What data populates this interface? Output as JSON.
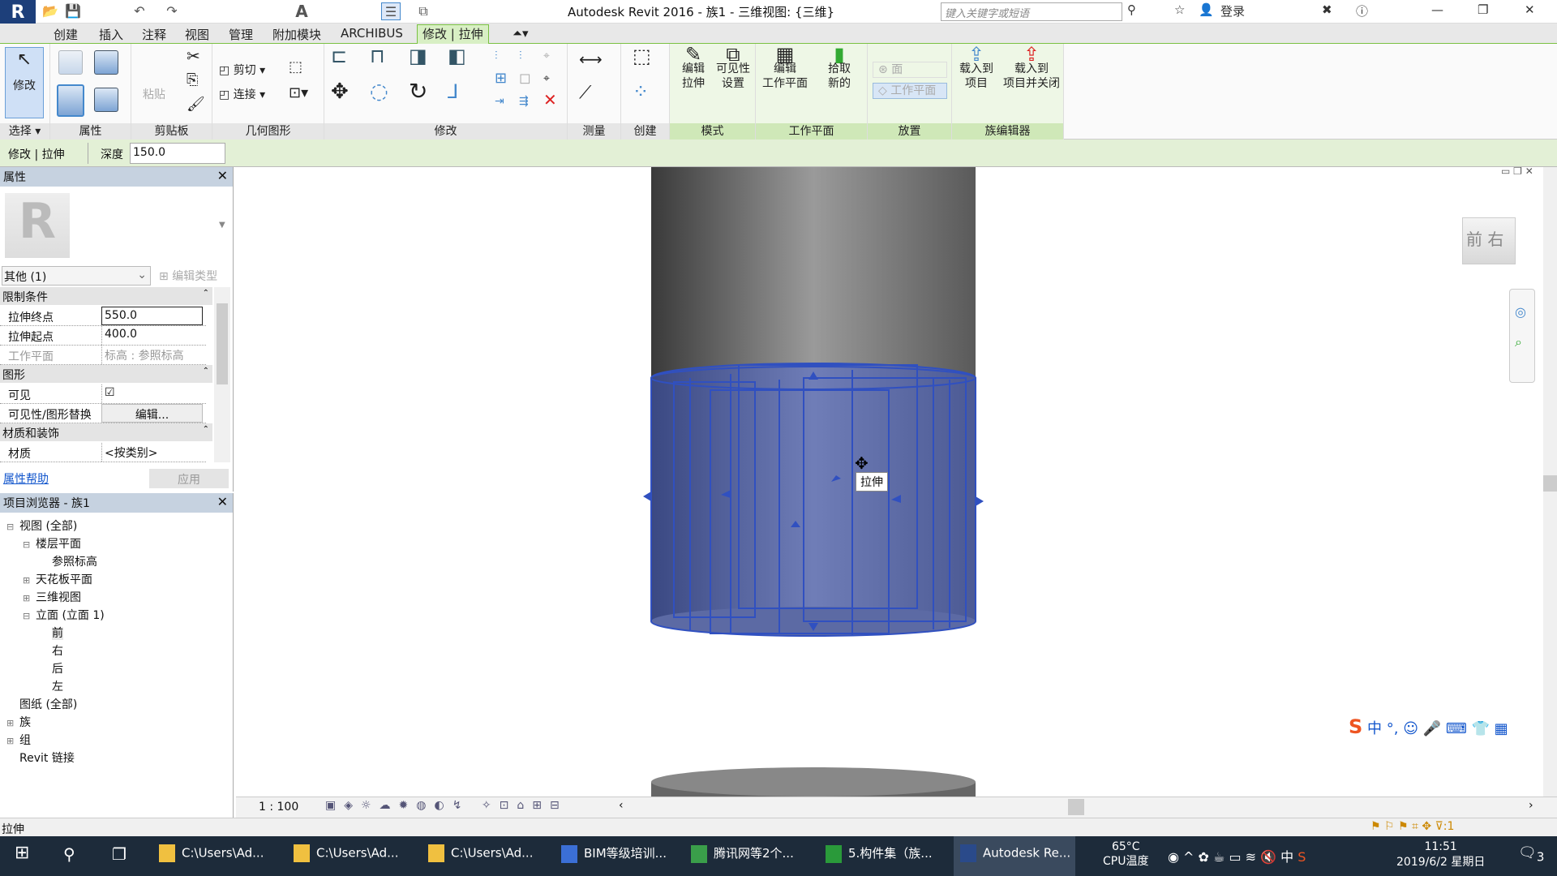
{
  "title": "Autodesk Revit 2016 -    族1 - 三维视图: {三维}",
  "search_placeholder": "键入关键字或短语",
  "login": "登录",
  "tabs": [
    "创建",
    "插入",
    "注释",
    "视图",
    "管理",
    "附加模块",
    "ARCHIBUS",
    "修改 | 拉伸"
  ],
  "ribbon": {
    "modify": "修改",
    "select": "选择 ▾",
    "properties": "属性",
    "clipboard": "剪贴板",
    "paste": "粘贴",
    "cut": "剪切",
    "join": "连接",
    "geometry": "几何图形",
    "modify_panel": "修改",
    "measure": "测量",
    "create": "创建",
    "edit_extrusion": [
      "编辑",
      "拉伸"
    ],
    "visibility": [
      "可见性",
      "设置"
    ],
    "mode": "模式",
    "edit_workplane": [
      "编辑",
      "工作平面"
    ],
    "pick_new": [
      "拾取",
      "新的"
    ],
    "workplane": "工作平面",
    "face": "面",
    "workplane_btn": "工作平面",
    "place": "放置",
    "load_project": [
      "载入到",
      "项目"
    ],
    "load_close": [
      "载入到",
      "项目并关闭"
    ],
    "family_editor": "族编辑器"
  },
  "optbar": {
    "context": "修改 | 拉伸",
    "depth_label": "深度",
    "depth_value": "150.0"
  },
  "properties": {
    "title": "属性",
    "type": "其他 (1)",
    "edit_type": "编辑类型",
    "categories": [
      "限制条件",
      "图形",
      "材质和装饰"
    ],
    "rows": [
      {
        "k": "拉伸终点",
        "v": "550.0"
      },
      {
        "k": "拉伸起点",
        "v": "400.0"
      },
      {
        "k": "工作平面",
        "v": "标高 : 参照标高"
      },
      {
        "k": "可见",
        "v": "☑"
      },
      {
        "k": "可见性/图形替换",
        "v": "编辑..."
      },
      {
        "k": "材质",
        "v": "<按类别>"
      }
    ],
    "help": "属性帮助",
    "apply": "应用"
  },
  "browser": {
    "title": "项目浏览器 - 族1",
    "nodes": [
      {
        "t": "视图 (全部)",
        "lvl": 0,
        "exp": "⊟"
      },
      {
        "t": "楼层平面",
        "lvl": 1,
        "exp": "⊟"
      },
      {
        "t": "参照标高",
        "lvl": 2,
        "exp": ""
      },
      {
        "t": "天花板平面",
        "lvl": 1,
        "exp": "⊞"
      },
      {
        "t": "三维视图",
        "lvl": 1,
        "exp": "⊞"
      },
      {
        "t": "立面 (立面 1)",
        "lvl": 1,
        "exp": "⊟"
      },
      {
        "t": "前",
        "lvl": 2,
        "exp": ""
      },
      {
        "t": "右",
        "lvl": 2,
        "exp": ""
      },
      {
        "t": "后",
        "lvl": 2,
        "exp": ""
      },
      {
        "t": "左",
        "lvl": 2,
        "exp": ""
      },
      {
        "t": "图纸 (全部)",
        "lvl": 0,
        "exp": ""
      },
      {
        "t": "族",
        "lvl": 0,
        "exp": "⊞"
      },
      {
        "t": "组",
        "lvl": 0,
        "exp": "⊞"
      },
      {
        "t": "Revit 链接",
        "lvl": 0,
        "exp": ""
      }
    ]
  },
  "view": {
    "tooltip": "拉伸",
    "viewcube": [
      "前",
      "右"
    ],
    "scale": "1 : 100"
  },
  "status": "拉伸",
  "taskbar": {
    "items": [
      "C:\\Users\\Ad...",
      "C:\\Users\\Ad...",
      "C:\\Users\\Ad...",
      "BIM等级培训...",
      "腾讯网等2个...",
      "5.构件集（族...",
      "Autodesk Re..."
    ],
    "temp": "65°C",
    "temp_label": "CPU温度",
    "ime": "中",
    "time": "11:51",
    "date": "2019/6/2 星期日",
    "notif": "3"
  },
  "colors": {
    "accent": "#7ac142",
    "selection": "#3050c0"
  }
}
